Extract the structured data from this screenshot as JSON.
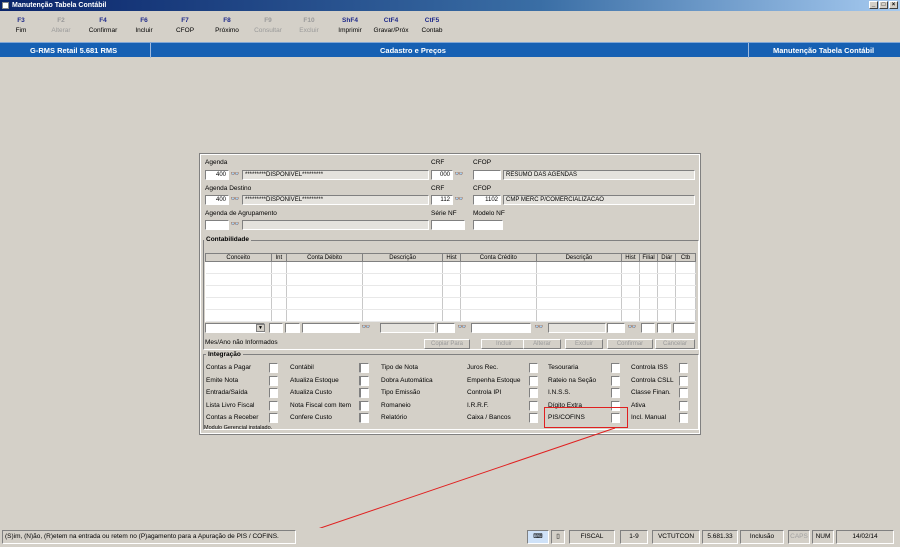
{
  "window": {
    "title": "Manutenção Tabela Contábil",
    "buttons": [
      "_",
      "□",
      "×"
    ]
  },
  "toolbar": [
    {
      "key": "F3",
      "label": "Fim",
      "enabled": true
    },
    {
      "key": "F2",
      "label": "Alterar",
      "enabled": false
    },
    {
      "key": "F4",
      "label": "Confirmar",
      "enabled": true
    },
    {
      "key": "F6",
      "label": "Incluir",
      "enabled": true
    },
    {
      "key": "F7",
      "label": "CFOP",
      "enabled": true
    },
    {
      "key": "F8",
      "label": "Próximo",
      "enabled": true
    },
    {
      "key": "F9",
      "label": "Consultar",
      "enabled": false
    },
    {
      "key": "F10",
      "label": "Excluir",
      "enabled": false
    },
    {
      "key": "ShF4",
      "label": "Imprimir",
      "enabled": true
    },
    {
      "key": "CtF4",
      "label": "Gravar/Próx",
      "enabled": true
    },
    {
      "key": "CtF5",
      "label": "Contab",
      "enabled": true
    }
  ],
  "header": {
    "left": "G-RMS Retail 5.681 RMS",
    "center": "Cadastro e Preços",
    "right": "Manutenção Tabela Contábil"
  },
  "form": {
    "agenda": {
      "label": "Agenda",
      "code": "400",
      "desc": "*********DISPONIVEL*********"
    },
    "crf1": {
      "label": "CRF",
      "value": "000"
    },
    "cfop1": {
      "label": "CFOP",
      "code": "",
      "desc": "RESUMO DAS AGENDAS"
    },
    "agenda_destino": {
      "label": "Agenda Destino",
      "code": "400",
      "desc": "*********DISPONIVEL*********"
    },
    "crf2": {
      "label": "CRF",
      "value": "112"
    },
    "cfop2": {
      "label": "CFOP",
      "code": "1102",
      "desc": "CMP MERC P/COMERCIALIZACAO"
    },
    "agenda_agrup": {
      "label": "Agenda de Agrupamento",
      "code": "",
      "desc": ""
    },
    "serie_nf": {
      "label": "Série NF",
      "value": ""
    },
    "modelo_nf": {
      "label": "Modelo NF",
      "value": ""
    },
    "binoculars_icon": "👓"
  },
  "contabilidade": {
    "title": "Contabilidade",
    "columns": [
      "Conceito",
      "Int",
      "Conta Débito",
      "Descrição",
      "Hist",
      "Conta Crédito",
      "Descrição",
      "Hist",
      "Filial",
      "Diár",
      "Ctb"
    ],
    "rows": [
      [
        "",
        "",
        "",
        "",
        "",
        "",
        "",
        "",
        "",
        "",
        ""
      ],
      [
        "",
        "",
        "",
        "",
        "",
        "",
        "",
        "",
        "",
        "",
        ""
      ],
      [
        "",
        "",
        "",
        "",
        "",
        "",
        "",
        "",
        "",
        "",
        ""
      ],
      [
        "",
        "",
        "",
        "",
        "",
        "",
        "",
        "",
        "",
        "",
        ""
      ],
      [
        "",
        "",
        "",
        "",
        "",
        "",
        "",
        "",
        "",
        "",
        ""
      ]
    ],
    "message": "Mes/Ano não Informados",
    "buttons": [
      "Copiar Para",
      "Incluir",
      "Alterar",
      "Excluir",
      "Confirmar",
      "Cancelar"
    ]
  },
  "integracao": {
    "title": "Integração",
    "col1": [
      "Contas a Pagar",
      "Emite Nota",
      "Entrada/Saída",
      "Lista Livro Fiscal",
      "Contas a Receber"
    ],
    "col2": [
      "Contábil",
      "Atualiza Estoque",
      "Atualiza Custo",
      "Nota Fiscal com Item",
      "Confere Custo"
    ],
    "col3": [
      "Tipo de Nota",
      "Dobra Automática",
      "Tipo Emissão",
      "Romaneio",
      "Relatório"
    ],
    "col4": [
      "Juros Rec.",
      "Empenha Estoque",
      "Controla IPI",
      "I.R.R.F.",
      "Caixa / Bancos"
    ],
    "col5": [
      "Tesouraria",
      "Rateio na Seção",
      "I.N.S.S.",
      "Dígito Extra",
      "PIS/COFINS"
    ],
    "col6": [
      "Controla ISS",
      "Controla CSLL",
      "Classe Finan.",
      "Ativa",
      "Incl. Manual"
    ],
    "footer": "Modulo Gerencial instalado."
  },
  "status": {
    "message": "(S)im, (N)ão, (R)etem na entrada ou retem no (P)agamento para a Apuração de PIS / COFINS.",
    "panels": [
      "FISCAL",
      "1-9",
      "VCTUTCON",
      "5.681.33",
      "Inclusão",
      "CAPS",
      "NUM",
      "14/02/14"
    ]
  },
  "colors": {
    "header_bg": "#1660b3",
    "highlight": "#e02020"
  }
}
